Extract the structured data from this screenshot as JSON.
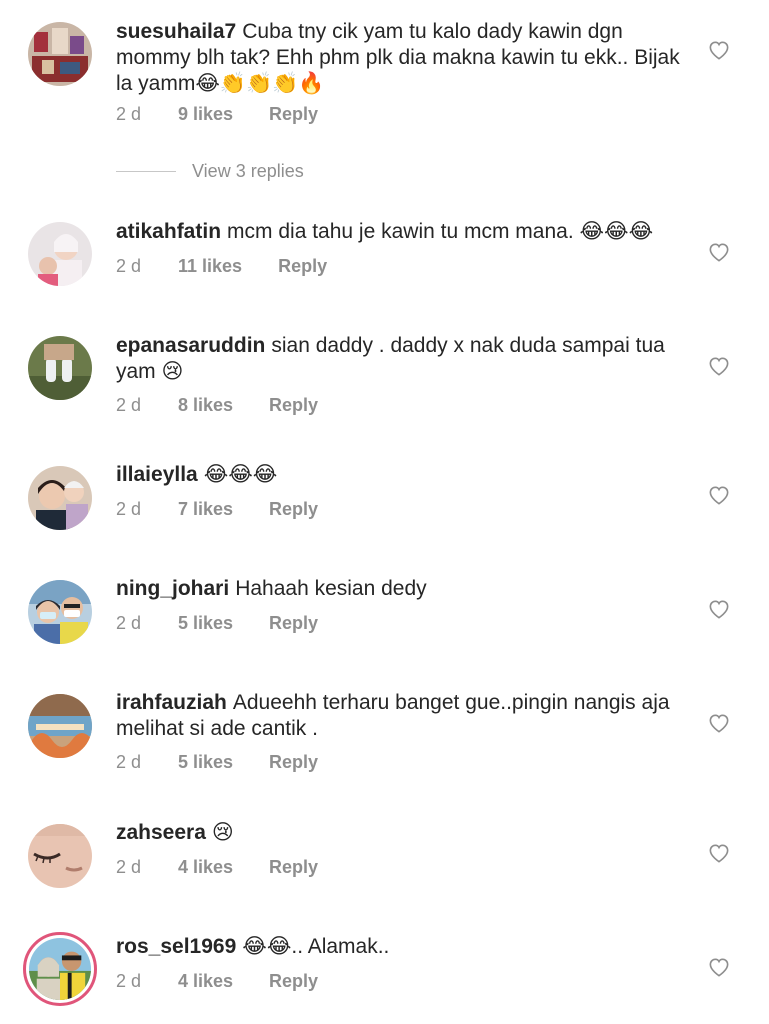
{
  "comments": [
    {
      "username": "suesuhaila7",
      "text": "Cuba tny cik yam tu kalo dady kawin dgn mommy blh tak? Ehh phm plk dia makna kawin tu ekk.. Bijak la yamm😂👏👏👏🔥",
      "time": "2 d",
      "likes": "9 likes",
      "reply": "Reply"
    },
    {
      "username": "atikahfatin",
      "text": "mcm dia tahu je kawin tu mcm mana. 😂😂😂",
      "time": "2 d",
      "likes": "11 likes",
      "reply": "Reply"
    },
    {
      "username": "epanasaruddin",
      "text": "sian daddy . daddy x nak duda sampai tua yam 😢",
      "time": "2 d",
      "likes": "8 likes",
      "reply": "Reply"
    },
    {
      "username": "illaieylla",
      "text": "😂😂😂",
      "time": "2 d",
      "likes": "7 likes",
      "reply": "Reply"
    },
    {
      "username": "ning_johari",
      "text": "Hahaah kesian dedy",
      "time": "2 d",
      "likes": "5 likes",
      "reply": "Reply"
    },
    {
      "username": "irahfauziah",
      "text": "Adueehh terharu banget gue..pingin nangis aja melihat si ade cantik .",
      "time": "2 d",
      "likes": "5 likes",
      "reply": "Reply"
    },
    {
      "username": "zahseera",
      "text": "😢",
      "time": "2 d",
      "likes": "4 likes",
      "reply": "Reply"
    },
    {
      "username": "ros_sel1969",
      "text": "😂😂.. Alamak..",
      "time": "2 d",
      "likes": "4 likes",
      "reply": "Reply"
    }
  ],
  "view_replies": "View 3 replies",
  "colors": {
    "text": "#262626",
    "meta": "#8e8e8e",
    "story_ring": "#e0557a"
  },
  "icons": {
    "like": "heart-outline-icon"
  }
}
